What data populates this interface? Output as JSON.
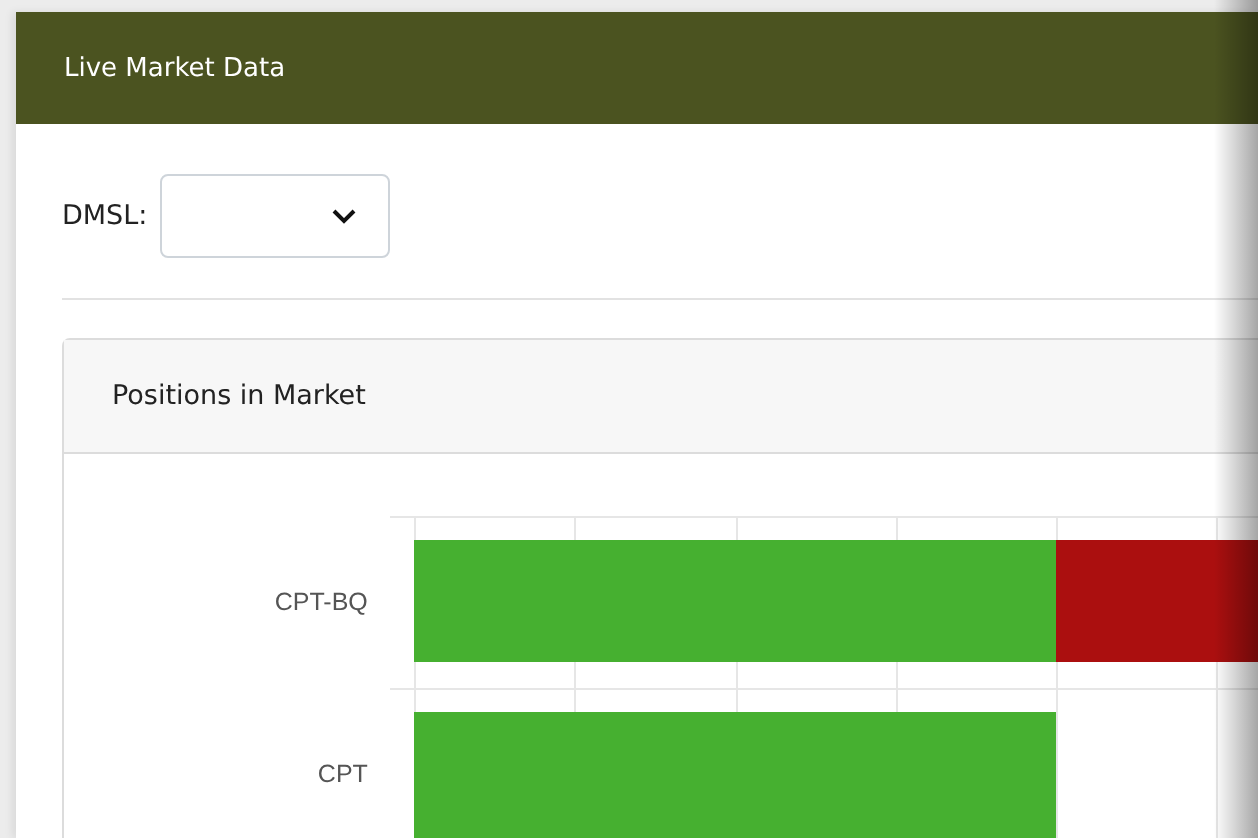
{
  "panel": {
    "title": "Live Market Data"
  },
  "filter": {
    "label": "DMSL:"
  },
  "positions": {
    "title": "Positions in Market",
    "rows": [
      {
        "label": "CPT-BQ",
        "kind": "split"
      },
      {
        "label": "CPT",
        "kind": "single"
      }
    ]
  }
}
